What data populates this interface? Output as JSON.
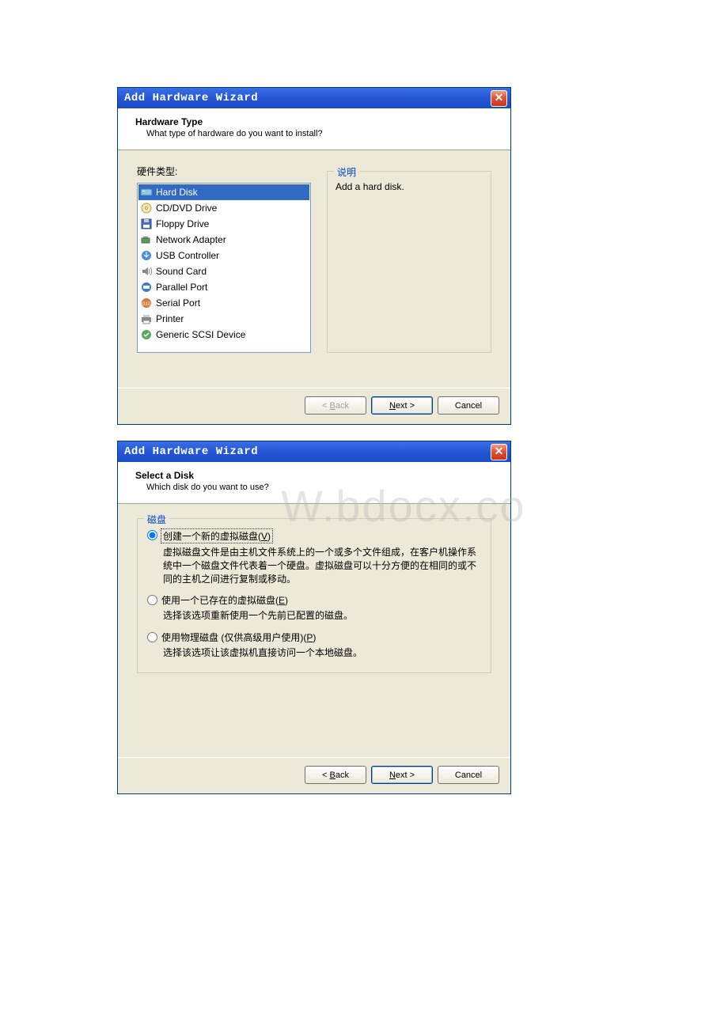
{
  "wizard1": {
    "title": "Add Hardware Wizard",
    "header_title": "Hardware Type",
    "header_sub": "What type of hardware do you want to install?",
    "hw_label": "硬件类型:",
    "desc_legend": "说明",
    "desc_text": "Add a hard disk.",
    "items": [
      {
        "label": "Hard Disk",
        "selected": true
      },
      {
        "label": "CD/DVD Drive"
      },
      {
        "label": "Floppy Drive"
      },
      {
        "label": "Network Adapter"
      },
      {
        "label": "USB Controller"
      },
      {
        "label": "Sound Card"
      },
      {
        "label": "Parallel Port"
      },
      {
        "label": "Serial Port"
      },
      {
        "label": "Printer"
      },
      {
        "label": "Generic SCSI Device"
      }
    ],
    "back": "< Back",
    "next": "Next >",
    "cancel": "Cancel"
  },
  "wizard2": {
    "title": "Add Hardware Wizard",
    "header_title": "Select a Disk",
    "header_sub": "Which disk do you want to use?",
    "disk_legend": "磁盘",
    "opt1_label": "创建一个新的虚拟磁盘(V)",
    "opt1_desc": "虚拟磁盘文件是由主机文件系统上的一个或多个文件组成，在客户机操作系统中一个磁盘文件代表着一个硬盘。虚拟磁盘可以十分方便的在相同的或不同的主机之间进行复制或移动。",
    "opt2_label": "使用一个已存在的虚拟磁盘(E)",
    "opt2_desc": "选择该选项重新使用一个先前已配置的磁盘。",
    "opt3_label": "使用物理磁盘 (仅供高级用户使用)(P)",
    "opt3_desc": "选择该选项让该虚拟机直接访问一个本地磁盘。",
    "back": "< Back",
    "next": "Next >",
    "cancel": "Cancel"
  },
  "watermark": "W.bdocx.co"
}
